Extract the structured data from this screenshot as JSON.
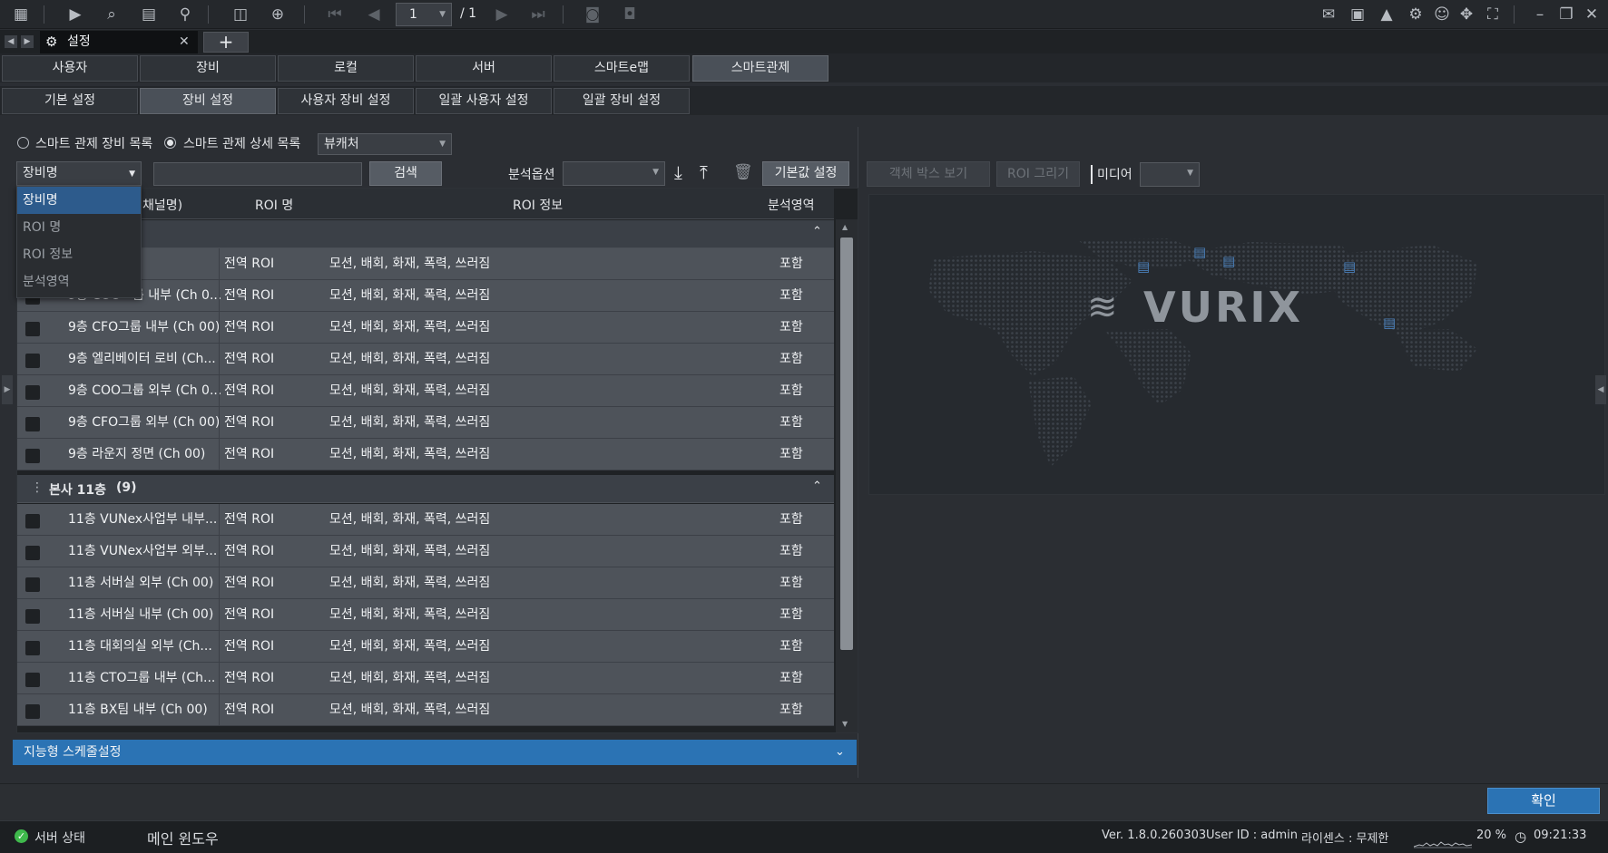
{
  "toolbar": {
    "page_current": "1",
    "page_total": "/ 1"
  },
  "document_tab": {
    "title": "설정"
  },
  "main_tabs": [
    "사용자",
    "장비",
    "로컬",
    "서버",
    "스마트e맵",
    "스마트관제"
  ],
  "sub_tabs": [
    "기본 설정",
    "장비 설정",
    "사용자 장비 설정",
    "일괄 사용자 설정",
    "일괄 장비 설정"
  ],
  "filters": {
    "radio_device_list": "스마트 관제 장비 목록",
    "radio_detail_list": "스마트 관제 상세 목록",
    "viewer_select": "뷰캐처",
    "search_field_select": "장비명",
    "search_button": "검색",
    "analysis_option_label": "분석옵션",
    "default_setting_button": "기본값 설정"
  },
  "search_field_options": [
    "장비명",
    "ROI 명",
    "ROI 정보",
    "분석영역"
  ],
  "grid": {
    "headers": {
      "name": "채널명)",
      "roi_name": "ROI 명",
      "roi_info": "ROI 정보",
      "area": "분석영역"
    },
    "group1": {
      "rows": [
        {
          "name": "면 (Ch 00)",
          "roi": "전역 ROI",
          "info": "모션, 배회, 화재, 폭력, 쓰러짐",
          "area": "포함"
        },
        {
          "name": "9층 COO그룹 내부 (Ch 0...",
          "roi": "전역 ROI",
          "info": "모션, 배회, 화재, 폭력, 쓰러짐",
          "area": "포함"
        },
        {
          "name": "9층 CFO그룹 내부 (Ch 00)",
          "roi": "전역 ROI",
          "info": "모션, 배회, 화재, 폭력, 쓰러짐",
          "area": "포함"
        },
        {
          "name": "9층 엘리베이터 로비 (Ch...",
          "roi": "전역 ROI",
          "info": "모션, 배회, 화재, 폭력, 쓰러짐",
          "area": "포함"
        },
        {
          "name": "9층 COO그룹 외부 (Ch 0...",
          "roi": "전역 ROI",
          "info": "모션, 배회, 화재, 폭력, 쓰러짐",
          "area": "포함"
        },
        {
          "name": "9층 CFO그룹 외부 (Ch 00)",
          "roi": "전역 ROI",
          "info": "모션, 배회, 화재, 폭력, 쓰러짐",
          "area": "포함"
        },
        {
          "name": "9층 라운지 정면 (Ch 00)",
          "roi": "전역 ROI",
          "info": "모션, 배회, 화재, 폭력, 쓰러짐",
          "area": "포함"
        }
      ]
    },
    "group2": {
      "title": "본사 11층",
      "count": "(9)",
      "rows": [
        {
          "name": "11층 VUNex사업부 내부...",
          "roi": "전역 ROI",
          "info": "모션, 배회, 화재, 폭력, 쓰러짐",
          "area": "포함"
        },
        {
          "name": "11층 VUNex사업부 외부...",
          "roi": "전역 ROI",
          "info": "모션, 배회, 화재, 폭력, 쓰러짐",
          "area": "포함"
        },
        {
          "name": "11층 서버실 외부 (Ch 00)",
          "roi": "전역 ROI",
          "info": "모션, 배회, 화재, 폭력, 쓰러짐",
          "area": "포함"
        },
        {
          "name": "11층 서버실 내부 (Ch 00)",
          "roi": "전역 ROI",
          "info": "모션, 배회, 화재, 폭력, 쓰러짐",
          "area": "포함"
        },
        {
          "name": "11층 대회의실 외부 (Ch...",
          "roi": "전역 ROI",
          "info": "모션, 배회, 화재, 폭력, 쓰러짐",
          "area": "포함"
        },
        {
          "name": "11층 CTO그룹 내부 (Ch...",
          "roi": "전역 ROI",
          "info": "모션, 배회, 화재, 폭력, 쓰러짐",
          "area": "포함"
        },
        {
          "name": "11층 BX팀 내부 (Ch 00)",
          "roi": "전역 ROI",
          "info": "모션, 배회, 화재, 폭력, 쓰러짐",
          "area": "포함"
        }
      ]
    }
  },
  "schedule_bar": "지능형 스케줄설정",
  "right_panel": {
    "object_box_button": "객체 박스 보기",
    "roi_draw_button": "ROI 그리기",
    "media_label": "미디어",
    "logo_text": "VURIX"
  },
  "confirm_button": "확인",
  "status": {
    "server_status": "서버 상태",
    "main_window": "메인 윈도우",
    "version": "Ver. 1.8.0.260303",
    "user": "User ID : admin",
    "license": "라이센스 : 무제한",
    "cpu": "20 %",
    "time": "09:21:33"
  },
  "colors": {
    "accent": "#2b73b4",
    "selected_item": "#2d5b8c",
    "status_ok": "#3fb94c"
  }
}
